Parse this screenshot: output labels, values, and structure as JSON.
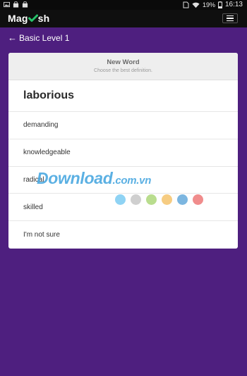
{
  "status_bar": {
    "battery": "19%",
    "time": "16:13"
  },
  "app_bar": {
    "logo_left": "Mag",
    "logo_right": "sh",
    "menu_icon": "hamburger-icon"
  },
  "nav": {
    "back_label": "Basic Level 1"
  },
  "card": {
    "title": "New Word",
    "subtitle": "Choose the best definition.",
    "word": "laborious",
    "options": [
      "demanding",
      "knowledgeable",
      "radical",
      "skilled",
      "I'm not sure"
    ]
  },
  "watermark": {
    "text_main": "Download",
    "text_domain": ".com.vn",
    "dot_colors": [
      "#8fd3f4",
      "#cfcfcf",
      "#b9dd8e",
      "#f6cc82",
      "#7cb6e0",
      "#f08c8c"
    ]
  },
  "colors": {
    "background": "#4e1f7f",
    "logo_check": "#27c26b"
  }
}
